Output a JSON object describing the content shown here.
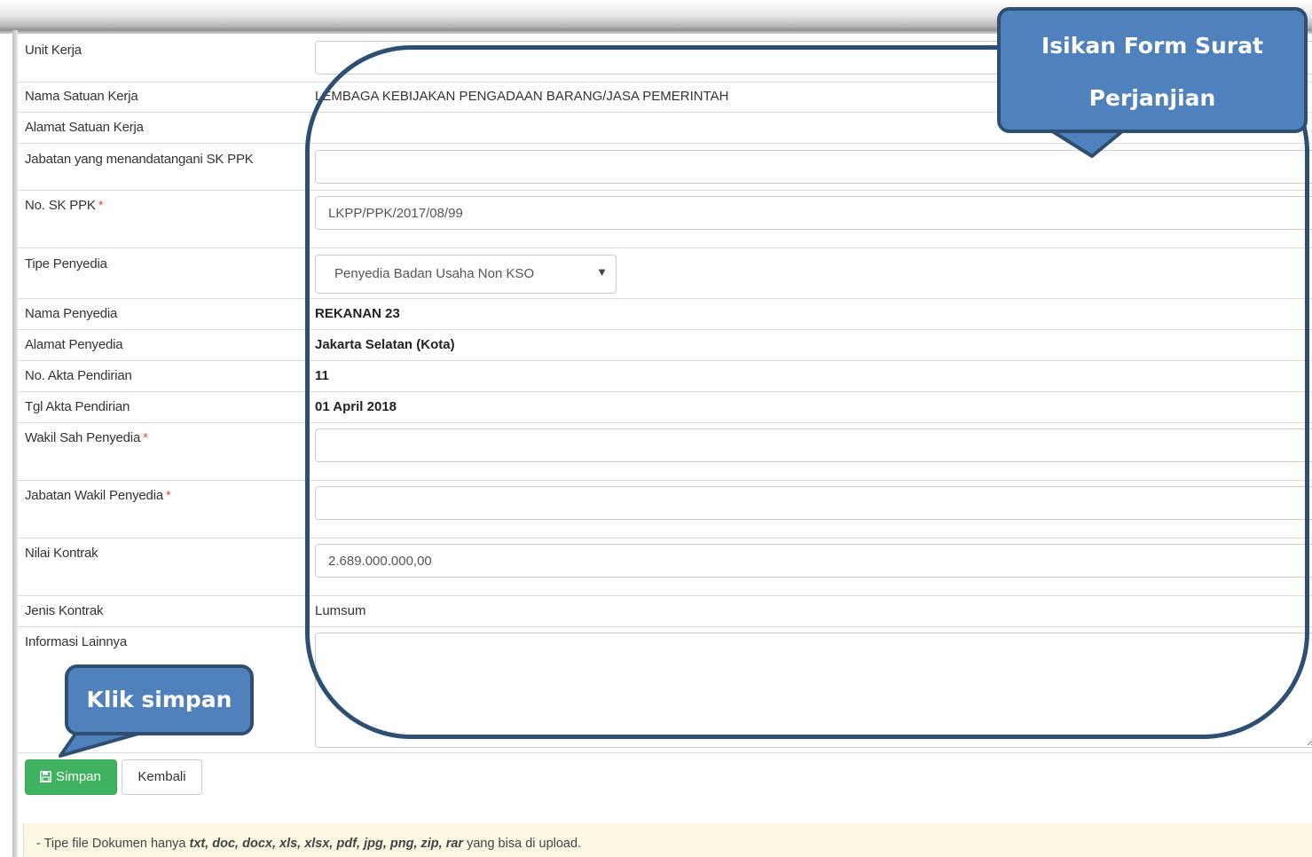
{
  "form": {
    "unit_kerja": {
      "label": "Unit Kerja",
      "value": ""
    },
    "nama_satuan_kerja": {
      "label": "Nama Satuan Kerja",
      "value": "LEMBAGA KEBIJAKAN PENGADAAN BARANG/JASA PEMERINTAH"
    },
    "alamat_satuan_kerja": {
      "label": "Alamat Satuan Kerja",
      "value": ""
    },
    "jabatan_ttd": {
      "label": "Jabatan yang menandatangani SK PPK",
      "value": ""
    },
    "no_sk_ppk": {
      "label": "No. SK PPK",
      "required_mark": "*",
      "value": "LKPP/PPK/2017/08/99"
    },
    "tipe_penyedia": {
      "label": "Tipe Penyedia",
      "selected": "Penyedia Badan Usaha Non KSO"
    },
    "nama_penyedia": {
      "label": "Nama Penyedia",
      "value": "REKANAN 23"
    },
    "alamat_penyedia": {
      "label": "Alamat Penyedia",
      "value": "Jakarta Selatan (Kota)"
    },
    "no_akta": {
      "label": "No. Akta Pendirian",
      "value": "11"
    },
    "tgl_akta": {
      "label": "Tgl Akta Pendirian",
      "value": "01 April 2018"
    },
    "wakil_sah": {
      "label": "Wakil Sah Penyedia",
      "required_mark": "*",
      "value": ""
    },
    "jabatan_wakil": {
      "label": "Jabatan Wakil Penyedia",
      "required_mark": "*",
      "value": ""
    },
    "nilai_kontrak": {
      "label": "Nilai Kontrak",
      "value": "2.689.000.000,00"
    },
    "jenis_kontrak": {
      "label": "Jenis Kontrak",
      "value": "Lumsum"
    },
    "informasi_lainnya": {
      "label": "Informasi Lainnya",
      "value": ""
    }
  },
  "buttons": {
    "save_label": "Simpan",
    "back_label": "Kembali"
  },
  "note": {
    "prefix": "- Tipe file Dokumen hanya ",
    "types": "txt, doc, docx, xls, xlsx, pdf, jpg, png, zip, rar",
    "suffix": " yang bisa di upload."
  },
  "callouts": {
    "form_hint_line1": "Isikan Form Surat",
    "form_hint_line2": "Perjanjian",
    "save_hint": "Klik simpan"
  },
  "colors": {
    "save_button": "#3fb35f",
    "callout_fill": "#4f81bd",
    "callout_border": "#2f4f72",
    "note_background": "#fcf8e3",
    "required": "#d9534f"
  },
  "icons": {
    "save": "floppy-disk-icon",
    "select": "caret-down-icon"
  }
}
